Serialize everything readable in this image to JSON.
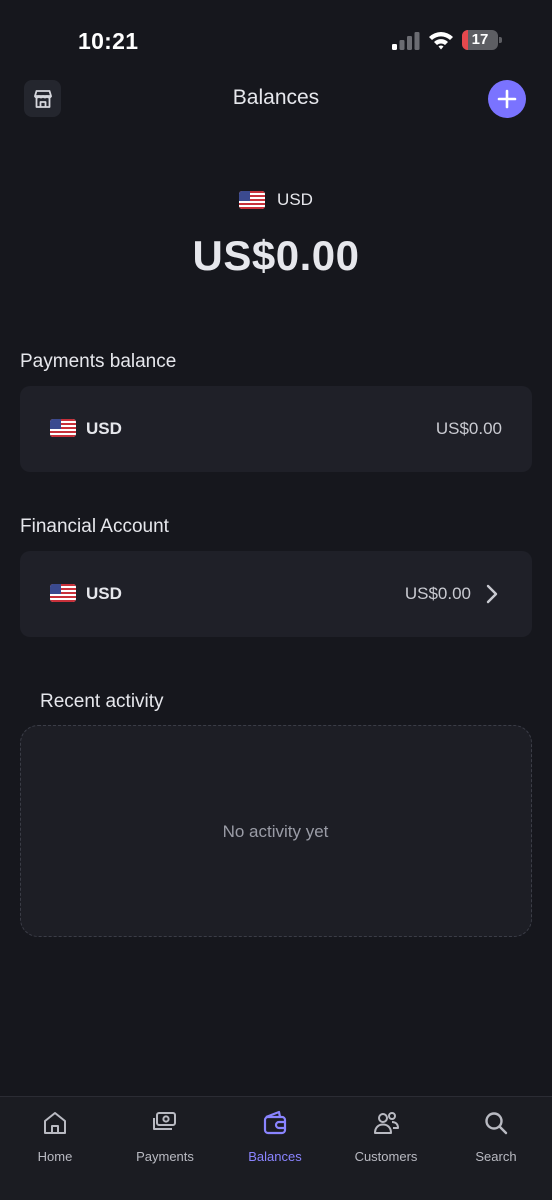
{
  "status_bar": {
    "time": "10:21",
    "battery_level": "17",
    "battery_fraction": 0.17
  },
  "header": {
    "title": "Balances"
  },
  "summary": {
    "currency_code": "USD",
    "amount": "US$0.00"
  },
  "payments_balance": {
    "title": "Payments balance",
    "currency_code": "USD",
    "amount": "US$0.00"
  },
  "financial_account": {
    "title": "Financial Account",
    "currency_code": "USD",
    "amount": "US$0.00"
  },
  "recent_activity": {
    "title": "Recent activity",
    "empty_text": "No activity yet"
  },
  "tabs": [
    {
      "label": "Home",
      "icon": "home-icon",
      "active": false
    },
    {
      "label": "Payments",
      "icon": "payments-icon",
      "active": false
    },
    {
      "label": "Balances",
      "icon": "wallet-icon",
      "active": true
    },
    {
      "label": "Customers",
      "icon": "customers-icon",
      "active": false
    },
    {
      "label": "Search",
      "icon": "search-icon",
      "active": false
    }
  ],
  "colors": {
    "background": "#16171d",
    "card": "#1f2028",
    "accent": "#7a73ff",
    "active_tab": "#8a84ff",
    "battery_low": "#e5484d"
  }
}
